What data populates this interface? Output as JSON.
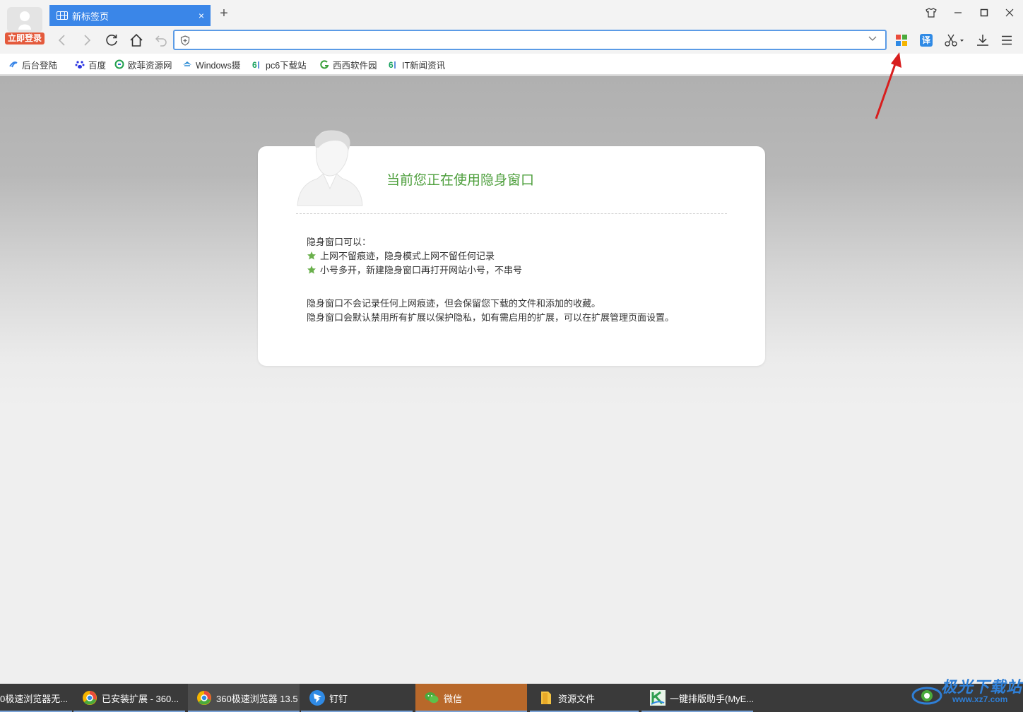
{
  "titlebar": {
    "login_badge": "立即登录",
    "tab_title": "新标签页",
    "tab_close": "×",
    "new_tab": "+"
  },
  "toolbar": {
    "address_value": "",
    "translate_label": "译"
  },
  "bookmarks": [
    {
      "label": "后台登陆",
      "icon": "swirl-icon",
      "color": "#3a86e8"
    },
    {
      "label": "百度",
      "icon": "paw-icon",
      "color": "#2932e1"
    },
    {
      "label": "欧菲资源网",
      "icon": "refresh-circle-icon",
      "color": "#22a04b"
    },
    {
      "label": "Windows摄",
      "icon": "windows-hat-icon",
      "color": "#2a8bd4"
    },
    {
      "label": "pc6下载站",
      "icon": "pc6-icon",
      "color": "#1aa260"
    },
    {
      "label": "西西软件园",
      "icon": "g-leaf-icon",
      "color": "#3aa03a"
    },
    {
      "label": "IT新闻资讯",
      "icon": "pc6-icon",
      "color": "#1aa260"
    }
  ],
  "incognito": {
    "title": "当前您正在使用隐身窗口",
    "can_heading": "隐身窗口可以：",
    "features": [
      "上网不留痕迹，隐身模式上网不留任何记录",
      "小号多开，新建隐身窗口再打开网站小号，不串号"
    ],
    "notes": [
      "隐身窗口不会记录任何上网痕迹，但会保留您下载的文件和添加的收藏。",
      "隐身窗口会默认禁用所有扩展以保护隐私，如有需启用的扩展，可以在扩展管理页面设置。"
    ],
    "accent_color": "#4e9f3d"
  },
  "taskbar": [
    {
      "label": "0极速浏览器无...",
      "icon": "none"
    },
    {
      "label": "已安装扩展 - 360...",
      "icon": "browser-360-icon"
    },
    {
      "label": "360极速浏览器 13.5",
      "icon": "browser-360-icon"
    },
    {
      "label": "钉钉",
      "icon": "dingtalk-icon"
    },
    {
      "label": "微信",
      "icon": "wechat-icon"
    },
    {
      "label": "资源文件",
      "icon": "folder-icon"
    },
    {
      "label": "一键排版助手(MyE...",
      "icon": "typeset-icon"
    }
  ],
  "watermark": {
    "main": "极光下载站",
    "sub": "www.xz7.com"
  }
}
